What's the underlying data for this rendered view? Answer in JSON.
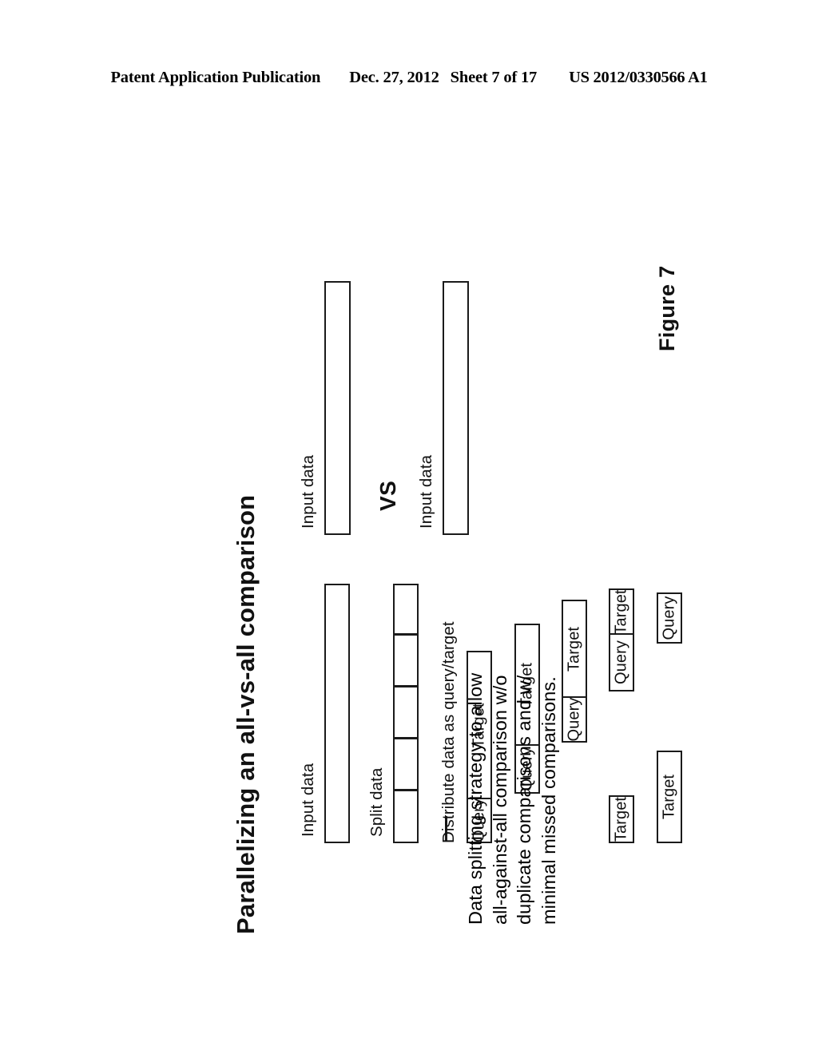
{
  "header": {
    "publication": "Patent Application Publication",
    "date": "Dec. 27, 2012",
    "sheet": "Sheet 7 of 17",
    "publication_number": "US 2012/0330566 A1"
  },
  "figure": {
    "title": "Parallelizing an all-vs-all comparison",
    "caption": "Figure 7",
    "description": "Data splitting strategy to allow\nall-against-all comparison w/o\nduplicate comparisons and w/\nminimal missed comparisons.",
    "labels": {
      "input_data": "Input data",
      "split_data": "Split data",
      "distribute": "Distribute data as query/target",
      "vs": "VS"
    },
    "box_labels": {
      "query": "Query",
      "target": "Target"
    },
    "split_segments": 5,
    "distribution_rows": [
      {
        "id": "row-1",
        "cells": [
          "Query",
          "Target"
        ]
      },
      {
        "id": "row-2",
        "cells": [
          "Query",
          "Target"
        ]
      },
      {
        "id": "row-3",
        "cells": [
          "Query",
          "Target"
        ]
      },
      {
        "id": "row-4",
        "cells": [
          "Query",
          "Target"
        ]
      },
      {
        "id": "row-5",
        "cells": [
          "Query"
        ]
      },
      {
        "id": "row-6",
        "cells": [
          "Target"
        ]
      },
      {
        "id": "row-7",
        "cells": [
          "Target"
        ]
      }
    ],
    "comparison": {
      "left_bar_label": "Input data",
      "right_bar_label": "Input data",
      "operator": "VS"
    }
  }
}
